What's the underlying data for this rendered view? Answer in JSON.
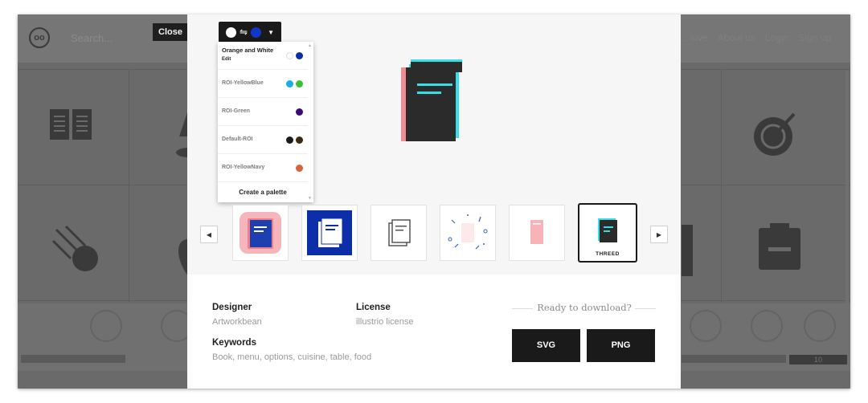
{
  "background": {
    "logo": "oo",
    "search_placeholder": "Search...",
    "nav": [
      "... love",
      "About us",
      "Login",
      "Sign up"
    ],
    "bottom_tab": "10"
  },
  "close_label": "Close",
  "palette": {
    "trigger": {
      "from_color": "#ffffff",
      "to_color": "#1037c8",
      "swap_glyph": "⇋"
    },
    "items": [
      {
        "name": "Orange and White",
        "edit": "Edit",
        "colors": [
          "#ffffff",
          "#0c2ea9"
        ]
      },
      {
        "name": "ROI-YellowBlue",
        "colors": [
          "#18aee8",
          "#3bbf36"
        ]
      },
      {
        "name": "ROI-Green",
        "colors": [
          "#3a0a78"
        ]
      },
      {
        "name": "Default-ROI",
        "colors": [
          "#1a1a1a",
          "#3b2a10"
        ]
      },
      {
        "name": "ROI-YellowNavy",
        "colors": [
          "#d9623c"
        ]
      }
    ],
    "create_label": "Create a palette"
  },
  "thumbnails": [
    {
      "style": "pink-gradient"
    },
    {
      "style": "blue-solid"
    },
    {
      "style": "outline"
    },
    {
      "style": "sparkle"
    },
    {
      "style": "pink-flat"
    },
    {
      "style": "threed",
      "label": "THREED",
      "selected": true
    }
  ],
  "info": {
    "designer_label": "Designer",
    "designer_value": "Artworkbean",
    "license_label": "License",
    "license_value": "illustrio license",
    "keywords_label": "Keywords",
    "keywords_value": "Book, menu, options, cuisine, table, food"
  },
  "download": {
    "prompt": "Ready to download?",
    "svg_label": "SVG",
    "png_label": "PNG"
  },
  "colors": {
    "accent_dark": "#1a1a1a",
    "cyan": "#33e0e8",
    "pink": "#f28a94"
  }
}
